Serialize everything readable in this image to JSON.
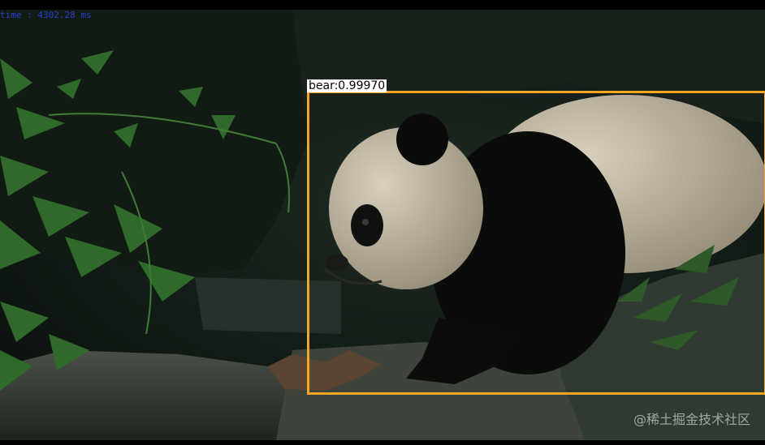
{
  "timing_text": "time : 4302.28 ms",
  "detection": {
    "label_text": "bear:0.99970",
    "class_name": "bear",
    "score": 0.9997,
    "box_color": "#f5a623"
  },
  "watermark": "@稀土掘金技术社区"
}
